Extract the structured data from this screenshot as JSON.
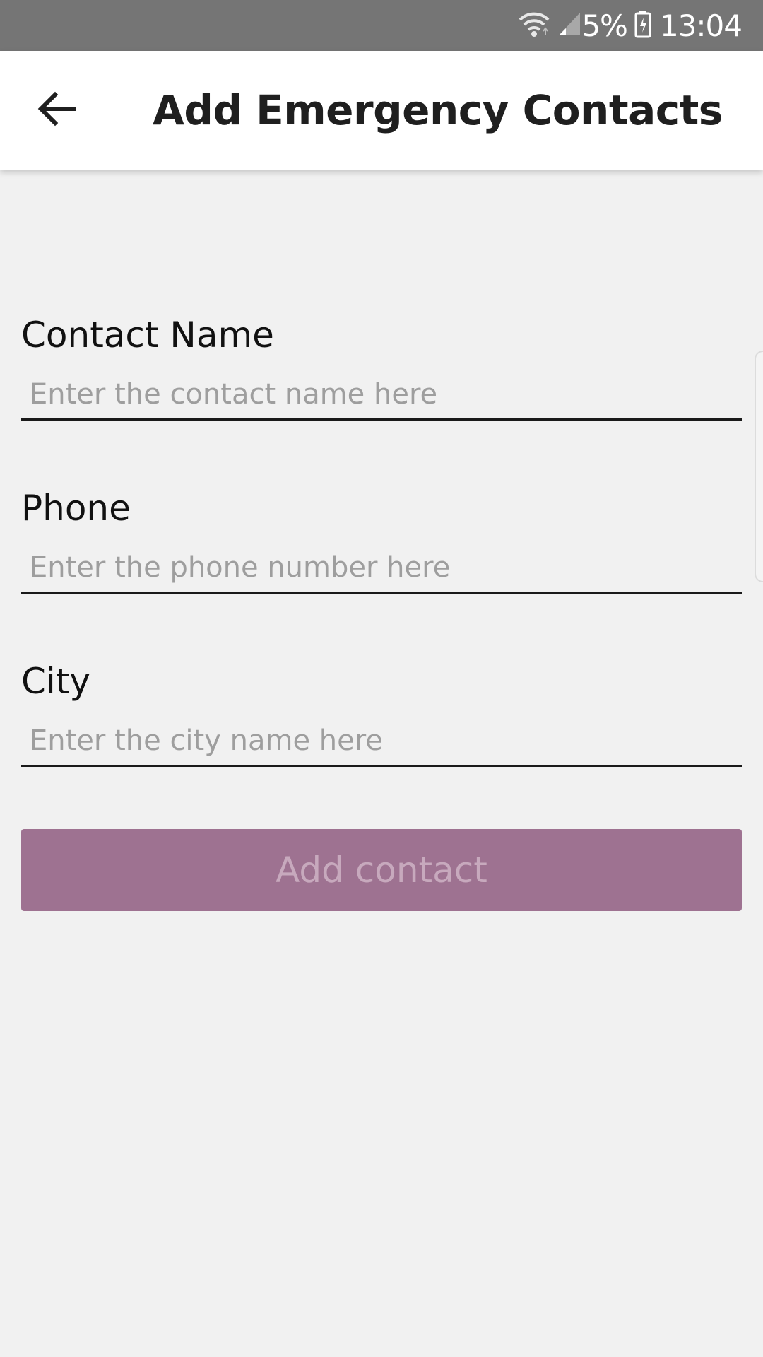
{
  "status_bar": {
    "battery_percent": "5%",
    "time": "13:04",
    "icons": [
      "wifi-icon",
      "signal-icon",
      "battery-icon"
    ]
  },
  "app_bar": {
    "title": "Add Emergency Contacts",
    "back_icon": "arrow-left-icon"
  },
  "form": {
    "contact_name": {
      "label": "Contact Name",
      "placeholder": "Enter the contact name here",
      "value": ""
    },
    "phone": {
      "label": "Phone",
      "placeholder": "Enter the phone number here",
      "value": ""
    },
    "city": {
      "label": "City",
      "placeholder": "Enter the city name here",
      "value": ""
    }
  },
  "add_button": {
    "label": "Add contact"
  },
  "colors": {
    "status_bar": "#757575",
    "app_bar": "#ffffff",
    "background": "#f1f1f1",
    "button": "#9e7291",
    "button_text": "#c7a9bd"
  }
}
